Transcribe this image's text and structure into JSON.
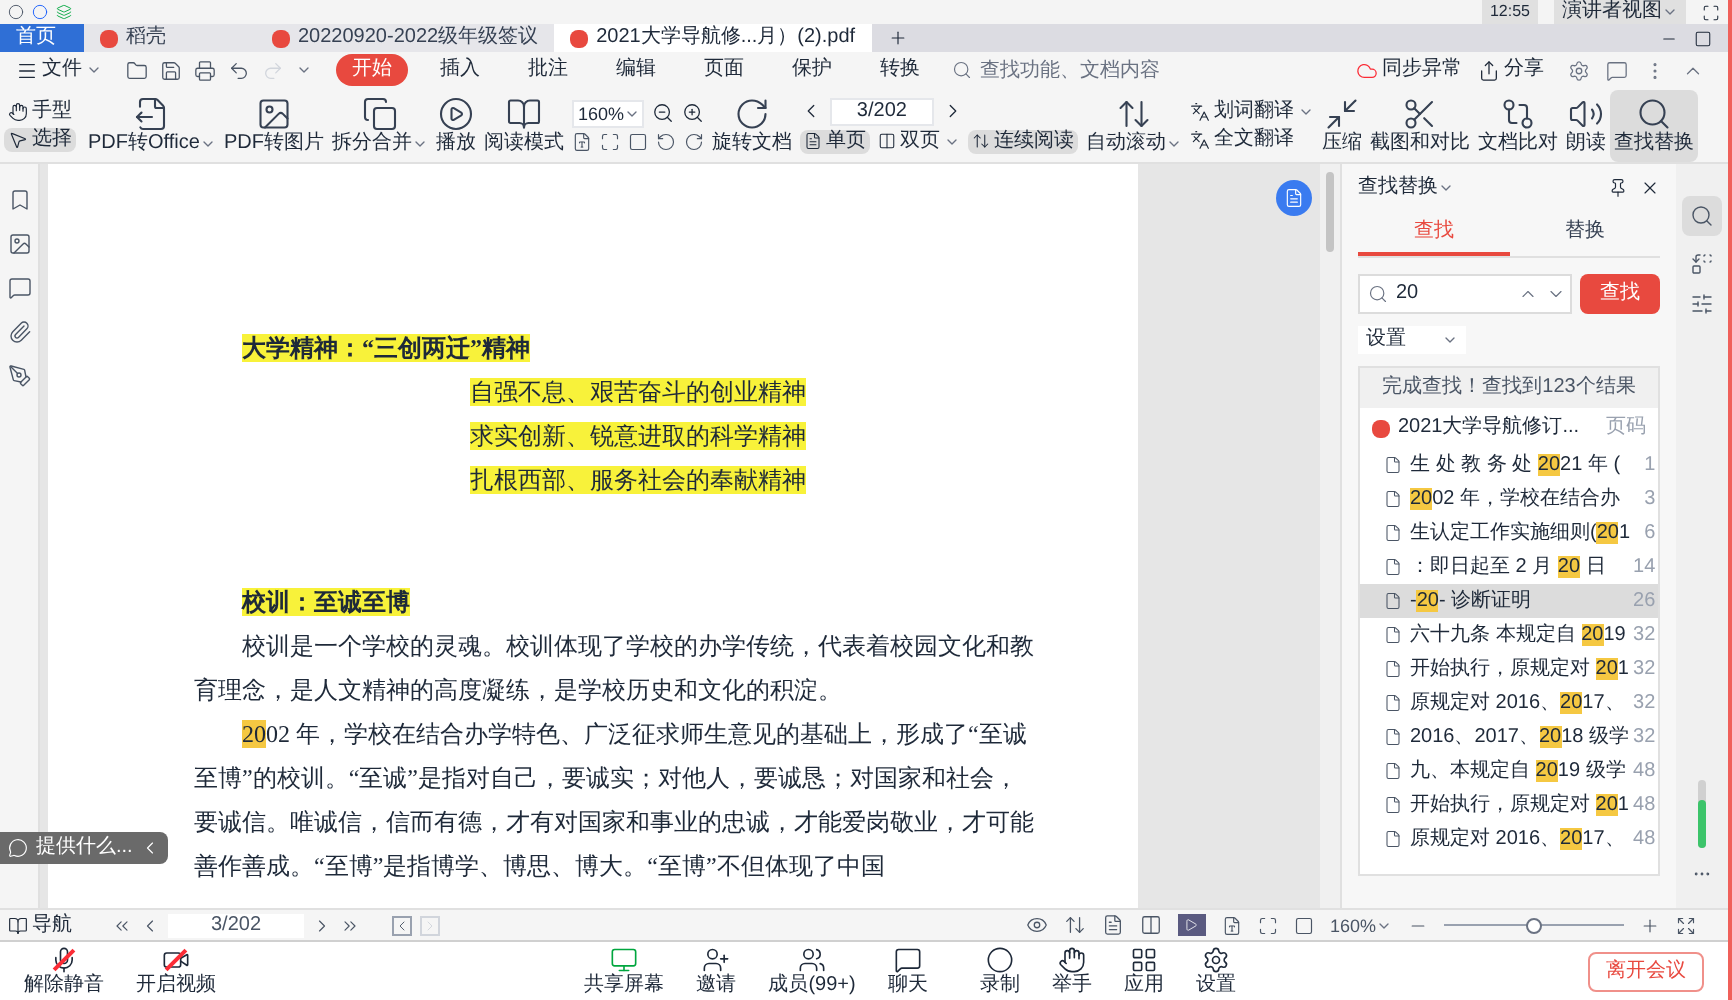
{
  "system_bar": {
    "time": "12:55",
    "presenter_view": "演讲者视图"
  },
  "tabs": [
    {
      "label": "首页",
      "kind": "home",
      "selected": false
    },
    {
      "label": "稻壳",
      "kind": "docer",
      "selected": false
    },
    {
      "label": "20220920-2022级年级签议",
      "kind": "doc",
      "selected": false
    },
    {
      "label": "2021大学导航修...月）(2).pdf",
      "kind": "doc",
      "selected": true
    }
  ],
  "menu": {
    "file": "文件",
    "items": [
      {
        "label": "开始",
        "selected": true
      },
      {
        "label": "插入",
        "selected": false
      },
      {
        "label": "批注",
        "selected": false
      },
      {
        "label": "编辑",
        "selected": false
      },
      {
        "label": "页面",
        "selected": false
      },
      {
        "label": "保护",
        "selected": false
      },
      {
        "label": "转换",
        "selected": false
      }
    ],
    "search_placeholder": "查找功能、文档内容",
    "sync": "同步异常",
    "share": "分享"
  },
  "toolbar": {
    "pointer_tools": [
      {
        "label": "手型",
        "selected": false
      },
      {
        "label": "选择",
        "selected": true
      }
    ],
    "left_buttons": [
      {
        "label": "PDF转Office",
        "has_menu": true
      },
      {
        "label": "PDF转图片",
        "has_menu": false
      },
      {
        "label": "拆分合并",
        "has_menu": true
      },
      {
        "label": "播放",
        "has_menu": false
      },
      {
        "label": "阅读模式",
        "has_menu": false
      }
    ],
    "zoom": "160%",
    "rotate": "旋转文档",
    "page": "3/202",
    "view_modes": [
      {
        "label": "单页",
        "selected": true,
        "has_menu": false
      },
      {
        "label": "双页",
        "selected": false,
        "has_menu": true
      },
      {
        "label": "连续阅读",
        "selected": true,
        "has_menu": false
      }
    ],
    "auto_scroll": "自动滚动",
    "translate": [
      {
        "label": "划词翻译",
        "has_menu": true
      },
      {
        "label": "全文翻译",
        "has_menu": false
      }
    ],
    "right_buttons": [
      {
        "label": "压缩",
        "selected": false
      },
      {
        "label": "截图和对比",
        "selected": false
      },
      {
        "label": "文档比对",
        "selected": false
      },
      {
        "label": "朗读",
        "selected": false
      },
      {
        "label": "查找替换",
        "selected": true
      }
    ]
  },
  "document": {
    "spirit": {
      "title": "大学精神：“三创两迁”精神",
      "lines": [
        "自强不息、艰苦奋斗的创业精神",
        "求实创新、锐意进取的科学精神",
        "扎根西部、服务社会的奉献精神"
      ]
    },
    "motto": {
      "title": "校训：至诚至博",
      "paragraph_1": "校训是一个学校的灵魂。校训体现了学校的办学传统，代表着校园文化和教育理念，是人文精神的高度凝练，是学校历史和文化的积淀。",
      "paragraph_2": {
        "match": "20",
        "rest": "02 年，学校在结合办学特色、广泛征求师生意见的基础上，形成了“至诚至博”的校训。“至诚”是指对自己，要诚实；对他人，要诚恳；对国家和社会，要诚信。唯诚信，信而有德，才有对国家和事业的忠诚，才能爱岗敬业，才可能善作善成。“至博”是指博学、博思、博大。“至博”不但体现了中国"
      }
    }
  },
  "floating_hint": "提供什么...",
  "find_panel": {
    "title": "查找替换",
    "tabs": [
      {
        "label": "查找",
        "selected": true
      },
      {
        "label": "替换",
        "selected": false
      }
    ],
    "query": "20",
    "find_button": "查找",
    "settings": "设置",
    "summary": "完成查找！查找到123个结果",
    "file": "2021大学导航修订...",
    "page_header": "页码",
    "results": [
      {
        "before": "生 处 教 务 处 ",
        "match": "20",
        "after": "21 年 (",
        "page": "1",
        "selected": false
      },
      {
        "match": "20",
        "after": "02 年，学校在结合办",
        "page": "3",
        "selected": false
      },
      {
        "before": "生认定工作实施细则(",
        "match": "20",
        "after": "1",
        "page": "6",
        "selected": false
      },
      {
        "before": "：即日起至 2 月 ",
        "match": "20",
        "after": " 日 ",
        "page": "14",
        "selected": false
      },
      {
        "before": "-",
        "match": "20",
        "after": "- 诊断证明",
        "page": "26",
        "selected": true
      },
      {
        "before": "六十九条 本规定自 ",
        "match": "20",
        "after": "19",
        "page": "32",
        "selected": false
      },
      {
        "before": "开始执行，原规定对 ",
        "match": "20",
        "after": "1",
        "page": "32",
        "selected": false
      },
      {
        "before": "原规定对 2016、",
        "match": "20",
        "after": "17、",
        "page": "32",
        "selected": false
      },
      {
        "before": "2016、2017、",
        "match": "20",
        "after": "18 级学",
        "page": "32",
        "selected": false
      },
      {
        "before": "九、本规定自 ",
        "match": "20",
        "after": "19 级学",
        "page": "48",
        "selected": false
      },
      {
        "before": "开始执行，原规定对 ",
        "match": "20",
        "after": "1",
        "page": "48",
        "selected": false
      },
      {
        "before": "原规定对 2016、",
        "match": "20",
        "after": "17、",
        "page": "48",
        "selected": false
      }
    ]
  },
  "status_bar": {
    "navigation": "导航",
    "page": "3/202",
    "zoom": "160%",
    "zoom_slider": {
      "level": 0.5
    }
  },
  "meeting_bar": {
    "items": [
      {
        "label": "解除静音",
        "kind": "mic",
        "off": true
      },
      {
        "label": "开启视频",
        "kind": "video",
        "off": true
      },
      {
        "label": "共享屏幕",
        "kind": "share",
        "off": false
      },
      {
        "label": "邀请",
        "kind": "invite",
        "off": false
      },
      {
        "label": "成员(99+)",
        "kind": "members",
        "off": false
      },
      {
        "label": "聊天",
        "kind": "chat",
        "off": false
      },
      {
        "label": "录制",
        "kind": "record",
        "off": false
      },
      {
        "label": "举手",
        "kind": "hand",
        "off": false
      },
      {
        "label": "应用",
        "kind": "apps",
        "off": false
      },
      {
        "label": "设置",
        "kind": "settings",
        "off": false
      }
    ],
    "leave": "离开会议"
  }
}
